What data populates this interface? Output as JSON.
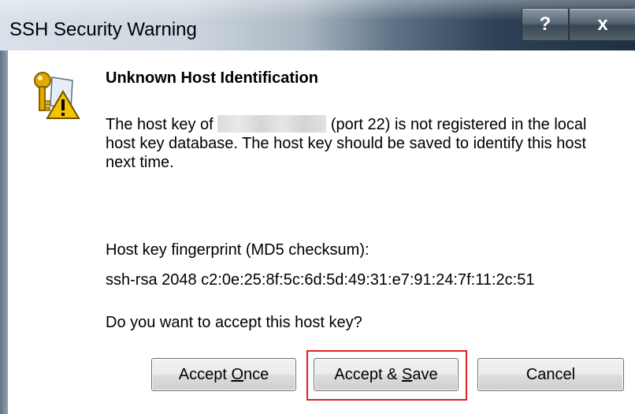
{
  "window": {
    "title": "SSH Security Warning",
    "help_label": "?",
    "close_label": "x"
  },
  "message": {
    "heading": "Unknown Host Identification",
    "para_part1": "The host key of ",
    "para_part2": " (port 22) is not registered in the local host key database. The host key should be saved to identify this host next time.",
    "fingerprint_label": "Host key fingerprint (MD5 checksum):",
    "fingerprint_value": "ssh-rsa 2048 c2:0e:25:8f:5c:6d:5d:49:31:e7:91:24:7f:11:2c:51",
    "question": "Do you want to accept this host key?"
  },
  "buttons": {
    "accept_once_pre": "Accept ",
    "accept_once_key": "O",
    "accept_once_post": "nce",
    "accept_save_pre": "Accept & ",
    "accept_save_key": "S",
    "accept_save_post": "ave",
    "cancel": "Cancel"
  },
  "icon": "key-warning-icon",
  "colors": {
    "highlight": "#e02020",
    "warning": "#f5c400"
  }
}
